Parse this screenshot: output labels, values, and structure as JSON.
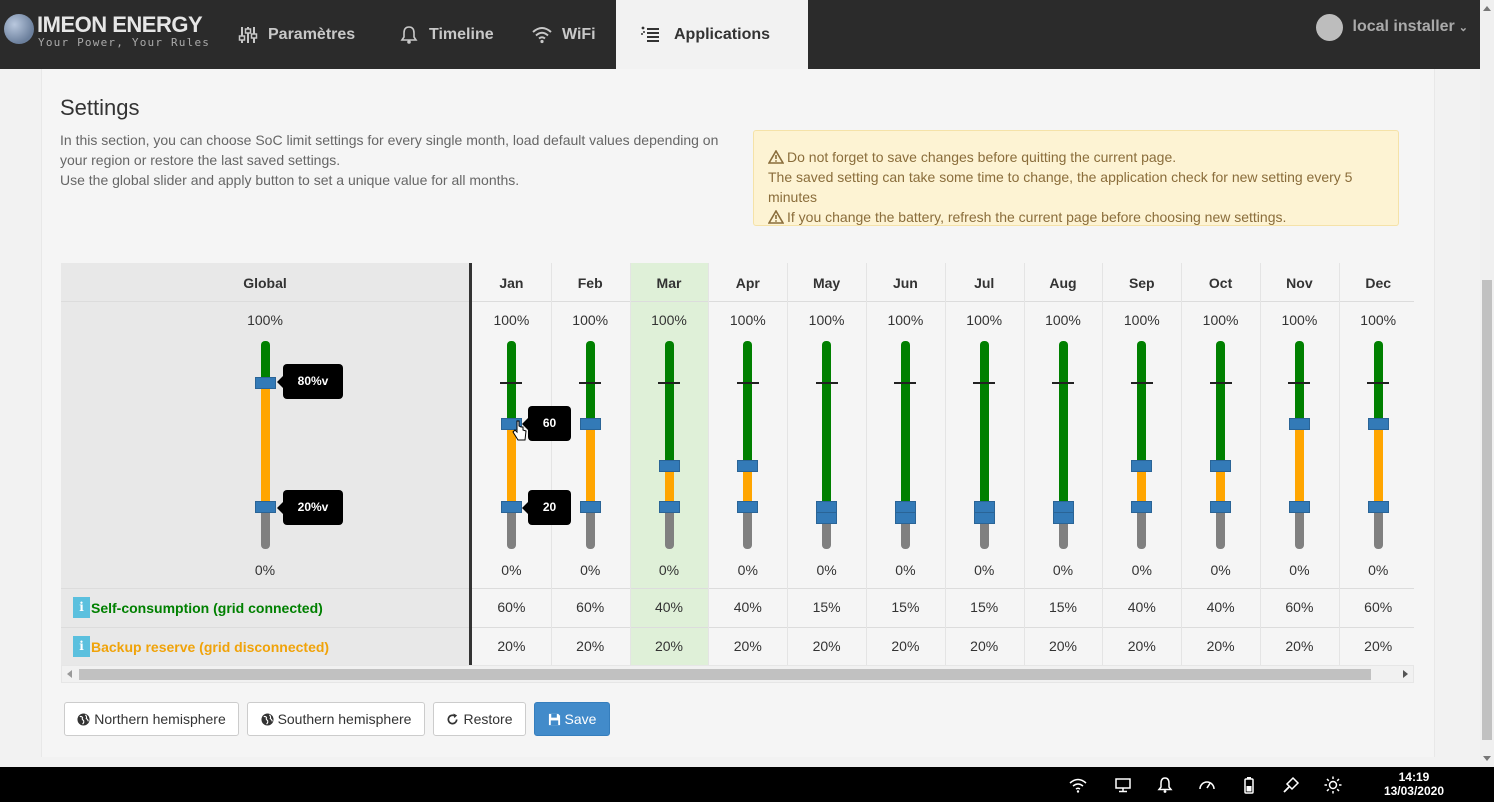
{
  "brand": {
    "name": "IMEON ENERGY",
    "tagline": "Your Power, Your Rules"
  },
  "nav": [
    {
      "label": "Paramètres",
      "icon": "sliders-icon"
    },
    {
      "label": "Timeline",
      "icon": "bell-icon"
    },
    {
      "label": "WiFi",
      "icon": "wifi-icon"
    },
    {
      "label": "Applications",
      "icon": "apps-list-icon",
      "active": true
    }
  ],
  "user": {
    "name": "local installer"
  },
  "settings": {
    "title": "Settings",
    "desc_lines": [
      "In this section, you can choose SoC limit settings for every single month, load default values depending on",
      "your region or restore the last saved settings.",
      "Use the global slider and apply button to set a unique value for all months."
    ]
  },
  "alert": {
    "line1": "Do not forget to save changes before quitting the current page.",
    "line2": "The saved setting can take some time to change, the application check for new setting every 5",
    "line3": "minutes",
    "line4": "If you change the battery, refresh the current page before choosing new settings."
  },
  "table": {
    "global_header": "Global",
    "max_label": "100%",
    "min_label": "0%",
    "global_upper": 80,
    "global_lower": 20,
    "global_upper_tip": "80%v",
    "global_lower_tip": "20%v",
    "row1_label": "Self-consumption (grid connected)",
    "row2_label": "Backup reserve (grid disconnected)",
    "colors": {
      "green": "#008000",
      "orange": "#ffa500",
      "gray": "#808080",
      "handle": "#337ab7",
      "highlight": "#dff0d8",
      "row1": "#008000",
      "row2": "#f0a30a"
    },
    "highlight_month": "Mar",
    "months": [
      {
        "name": "Jan",
        "max": "100%",
        "min": "0%",
        "self": "60%",
        "backup": "20%",
        "upper": 60,
        "lower": 20
      },
      {
        "name": "Feb",
        "max": "100%",
        "min": "0%",
        "self": "60%",
        "backup": "20%",
        "upper": 60,
        "lower": 20
      },
      {
        "name": "Mar",
        "max": "100%",
        "min": "0%",
        "self": "40%",
        "backup": "20%",
        "upper": 40,
        "lower": 20
      },
      {
        "name": "Apr",
        "max": "100%",
        "min": "0%",
        "self": "40%",
        "backup": "20%",
        "upper": 40,
        "lower": 20
      },
      {
        "name": "May",
        "max": "100%",
        "min": "0%",
        "self": "15%",
        "backup": "20%",
        "upper": 15,
        "lower": 20
      },
      {
        "name": "Jun",
        "max": "100%",
        "min": "0%",
        "self": "15%",
        "backup": "20%",
        "upper": 15,
        "lower": 20
      },
      {
        "name": "Jul",
        "max": "100%",
        "min": "0%",
        "self": "15%",
        "backup": "20%",
        "upper": 15,
        "lower": 20
      },
      {
        "name": "Aug",
        "max": "100%",
        "min": "0%",
        "self": "15%",
        "backup": "20%",
        "upper": 15,
        "lower": 20
      },
      {
        "name": "Sep",
        "max": "100%",
        "min": "0%",
        "self": "40%",
        "backup": "20%",
        "upper": 40,
        "lower": 20
      },
      {
        "name": "Oct",
        "max": "100%",
        "min": "0%",
        "self": "40%",
        "backup": "20%",
        "upper": 40,
        "lower": 20
      },
      {
        "name": "Nov",
        "max": "100%",
        "min": "0%",
        "self": "60%",
        "backup": "20%",
        "upper": 60,
        "lower": 20
      },
      {
        "name": "Dec",
        "max": "100%",
        "min": "0%",
        "self": "60%",
        "backup": "20%",
        "upper": 60,
        "lower": 20
      }
    ],
    "jan_upper_tip": "60",
    "jan_lower_tip": "20"
  },
  "buttons": {
    "northern": "Northern hemisphere",
    "southern": "Southern hemisphere",
    "restore": "Restore",
    "save": "Save"
  },
  "taskbar": {
    "time": "14:19",
    "date": "13/03/2020"
  }
}
